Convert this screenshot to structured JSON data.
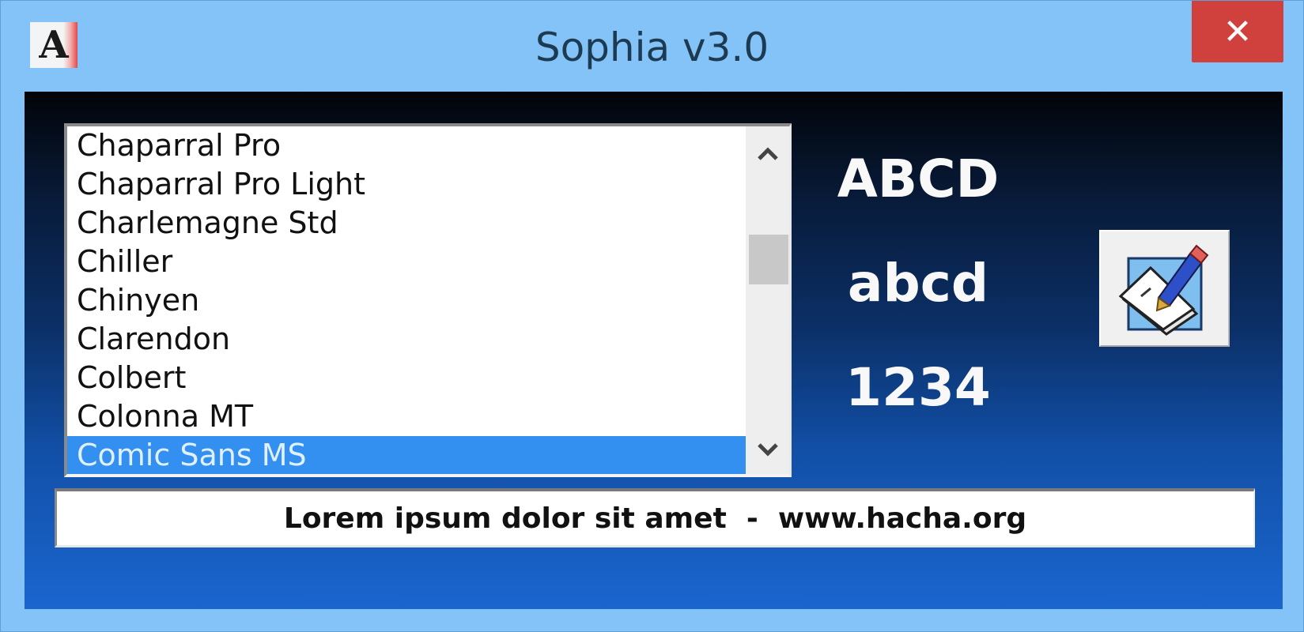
{
  "window": {
    "title": "Sophia v3.0",
    "app_icon_glyph": "A",
    "close_label": "✕"
  },
  "font_list": {
    "items": [
      {
        "label": "Chaparral Pro",
        "selected": false
      },
      {
        "label": "Chaparral Pro Light",
        "selected": false
      },
      {
        "label": "Charlemagne Std",
        "selected": false
      },
      {
        "label": "Chiller",
        "selected": false
      },
      {
        "label": "Chinyen",
        "selected": false
      },
      {
        "label": "Clarendon",
        "selected": false
      },
      {
        "label": "Colbert",
        "selected": false
      },
      {
        "label": "Colonna MT",
        "selected": false
      },
      {
        "label": "Comic Sans MS",
        "selected": true
      }
    ],
    "selected_font": "Comic Sans MS",
    "scroll_up_icon": "chevron-up-icon",
    "scroll_down_icon": "chevron-down-icon"
  },
  "preview": {
    "uppercase": "ABCD",
    "lowercase": "abcd",
    "digits": "1234"
  },
  "edit_button": {
    "icon": "edit-document-pencil-icon"
  },
  "status": {
    "text": "Lorem ipsum dolor sit amet  -  www.hacha.org"
  },
  "colors": {
    "titlebar": "#84c3f7",
    "close_button": "#d0403d",
    "selection": "#3390f0",
    "client_top": "#020408",
    "client_bottom": "#1a66cf"
  }
}
